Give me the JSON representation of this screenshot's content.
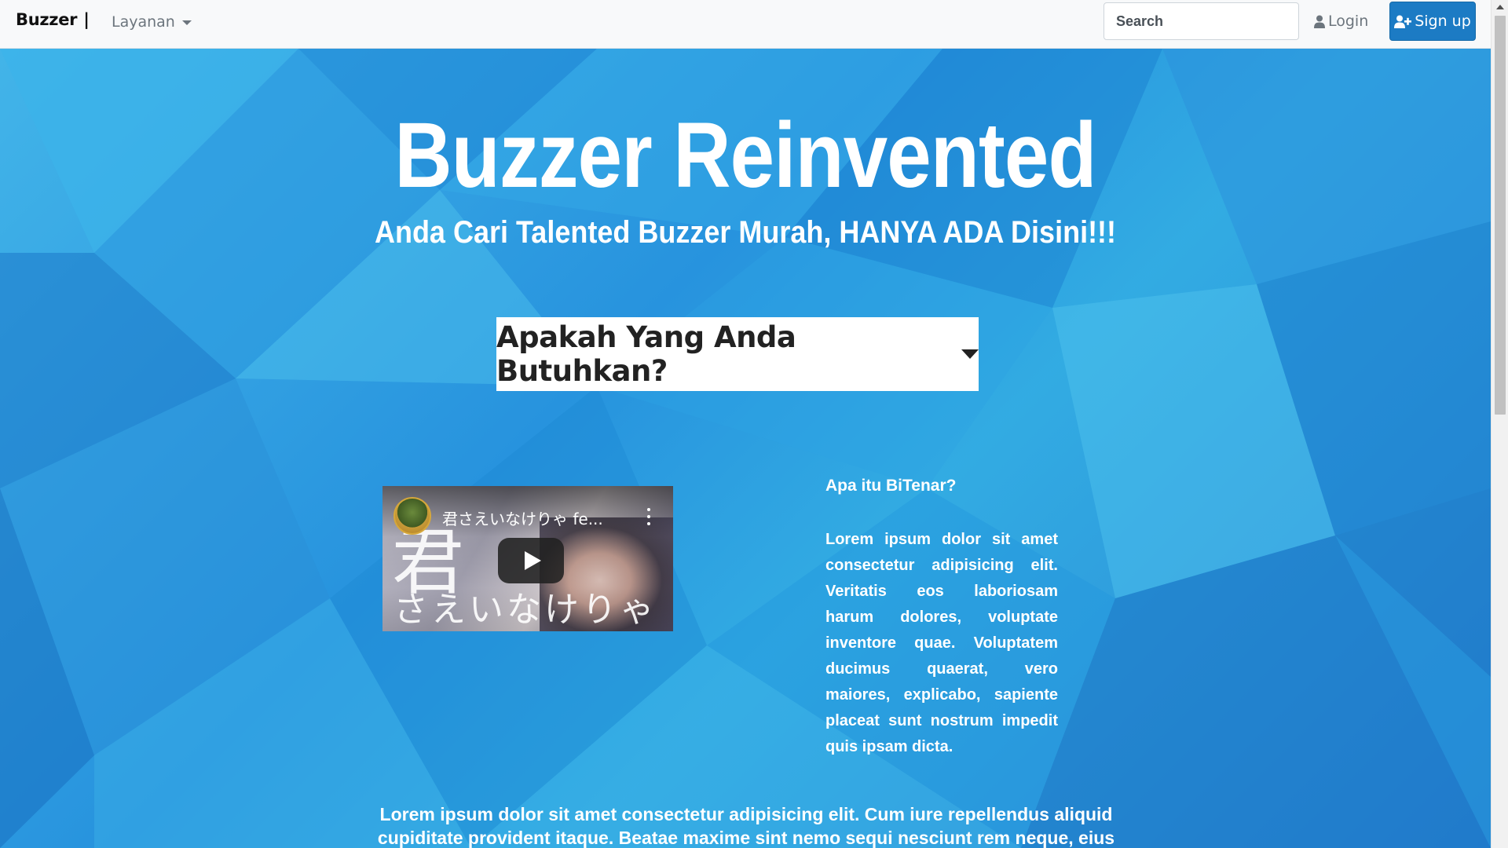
{
  "navbar": {
    "brand": "Buzzer",
    "brand_separator": "|",
    "dropdown_label": "Layanan",
    "search_placeholder": "Search",
    "login_label": "Login",
    "signup_label": "Sign up"
  },
  "hero": {
    "title": "Buzzer Reinvented",
    "subtitle": "Anda Cari Talented Buzzer Murah, HANYA ADA Disini!!!",
    "need_dropdown_label": "Apakah Yang Anda Butuhkan?"
  },
  "video": {
    "title": "君さえいなけりゃ fe...",
    "overlay_kanji": "君",
    "overlay_kana": "さえいなけりゃ"
  },
  "about": {
    "heading": "Apa itu BiTenar?",
    "body": "Lorem ipsum dolor sit amet consectetur adipisicing elit. Veritatis eos laboriosam harum dolores, voluptate inventore quae. Voluptatem ducimus quaerat, vero maiores, explicabo, sapiente placeat sunt nostrum impedit quis ipsam dicta."
  },
  "bottom_text": "Lorem ipsum dolor sit amet consectetur adipisicing elit. Cum iure repellendus aliquid cupiditate provident itaque. Beatae maxime sint nemo sequi nesciunt rem neque, eius",
  "icons": {
    "login": "user-icon",
    "signup": "user-plus-icon",
    "dropdown": "chevron-down-icon",
    "play": "play-icon"
  },
  "colors": {
    "hero_background": "#2a9ce0",
    "signup_button": "#1c7bc4",
    "navbar_background": "#f8f9fa"
  }
}
